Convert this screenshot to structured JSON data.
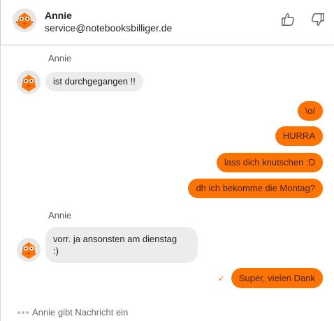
{
  "contact": {
    "name": "Annie",
    "email": "service@notebooksbilliger.de"
  },
  "header": {
    "thumbs_up_icon": "thumbs-up-icon",
    "thumbs_down_icon": "thumbs-down-icon"
  },
  "messages": {
    "group1_sender": "Annie",
    "in1": "ist durchgegangen !!",
    "out1": "\\o/",
    "out2": "HURRA",
    "out3": "lass dich knutschen :D",
    "out4": "dh ich bekomme die Montag?",
    "group2_sender": "Annie",
    "in2_line1": "vorr. ja ansonsten am dienstag",
    "in2_line2": ":)",
    "out5": "Super, vielen Dank",
    "sent_check": "✓"
  },
  "typing_indicator": "Annie gibt Nachricht ein",
  "colors": {
    "accent": "#ff7300",
    "incoming_bubble": "#ececec"
  }
}
